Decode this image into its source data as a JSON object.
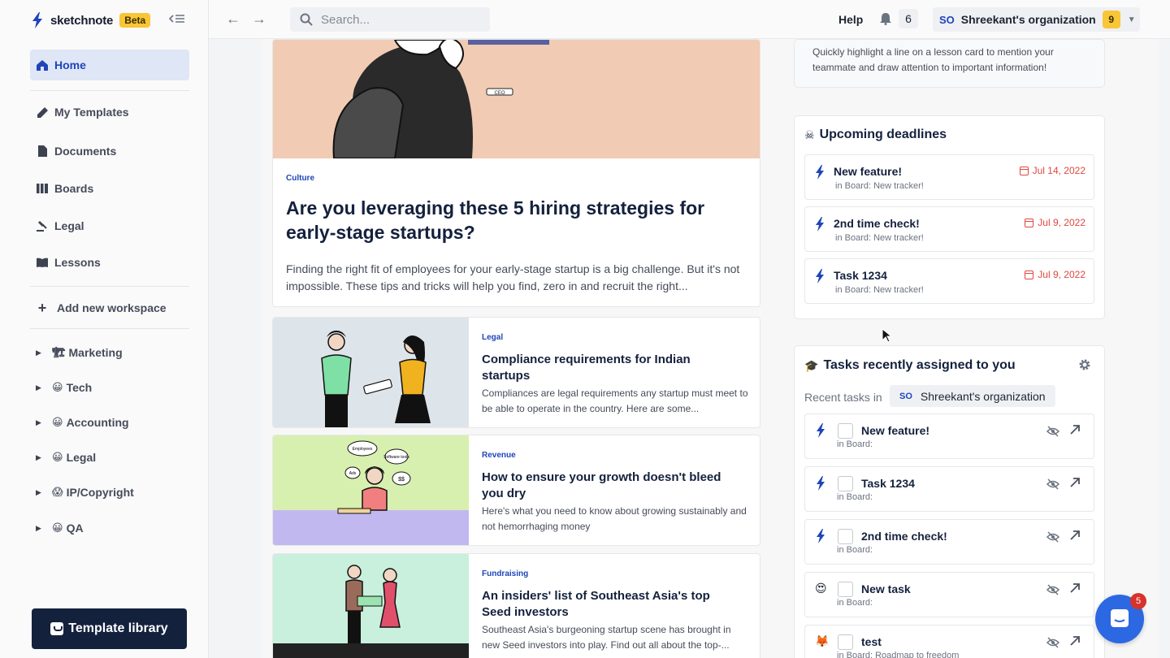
{
  "app": {
    "name": "sketchnote",
    "badge": "Beta"
  },
  "colors": {
    "brand_blue": "#1f45b8",
    "accent_yellow": "#f8c636",
    "deadline_red": "#e0463f",
    "dark_button": "#14213d"
  },
  "sidebar": {
    "nav": [
      {
        "label": "Home",
        "icon": "home-icon",
        "active": true
      },
      {
        "label": "My Templates",
        "icon": "pen-icon"
      },
      {
        "label": "Documents",
        "icon": "document-icon"
      },
      {
        "label": "Boards",
        "icon": "board-icon"
      },
      {
        "label": "Legal",
        "icon": "gavel-icon"
      },
      {
        "label": "Lessons",
        "icon": "book-icon"
      }
    ],
    "add_workspace": "Add new workspace",
    "workspaces": [
      {
        "label": "Marketing",
        "emoji": "🏗"
      },
      {
        "label": "Tech",
        "emoji": "😀"
      },
      {
        "label": "Accounting",
        "emoji": "😀"
      },
      {
        "label": "Legal",
        "emoji": "😀"
      },
      {
        "label": "IP/Copyright",
        "emoji": "😱"
      },
      {
        "label": "QA",
        "emoji": "😀"
      }
    ],
    "template_library": "Template library"
  },
  "topbar": {
    "search_placeholder": "Search...",
    "help": "Help",
    "notifications": "6",
    "org": {
      "abbr": "SO",
      "name": "Shreekant's organization",
      "count": "9"
    }
  },
  "feed": {
    "hero": {
      "badge_text": "CEO",
      "category": "Culture",
      "title": "Are you leveraging these 5 hiring strategies for early-stage startups?",
      "desc": "Finding the right fit of employees for your early-stage startup is a big challenge. But it's not impossible. These tips and tricks will help you find, zero in and recruit the right..."
    },
    "articles": [
      {
        "category": "Legal",
        "title": "Compliance requirements for Indian startups",
        "desc": "Compliances are legal requirements any startup must meet to be able to operate in the country. Here are some..."
      },
      {
        "category": "Revenue",
        "title": "How to ensure your growth doesn't bleed you dry",
        "desc": "Here's what you need to know about growing sustainably and not hemorrhaging money",
        "thumb_labels": [
          "Employees",
          "Software tools",
          "Ads",
          "$$"
        ]
      },
      {
        "category": "Fundraising",
        "title": "An insiders' list of Southeast Asia's top Seed investors",
        "desc": "Southeast Asia's burgeoning startup scene has brought in new Seed investors into play. Find out all about the top-..."
      }
    ]
  },
  "right": {
    "tip_text": "Quickly highlight a line on a lesson card to mention your teammate and draw attention to important information!",
    "deadlines": {
      "title": "Upcoming deadlines",
      "emoji": "☠",
      "items": [
        {
          "name": "New feature!",
          "board": "in Board: New tracker!",
          "date": "Jul 14, 2022"
        },
        {
          "name": "2nd time check!",
          "board": "in Board: New tracker!",
          "date": "Jul 9, 2022"
        },
        {
          "name": "Task 1234",
          "board": "in Board: New tracker!",
          "date": "Jul 9, 2022"
        }
      ]
    },
    "tasks": {
      "title": "Tasks recently assigned to you",
      "emoji": "🎓",
      "recent_label": "Recent tasks in",
      "org_abbr": "SO",
      "org_name": "Shreekant's organization",
      "items": [
        {
          "name": "New feature!",
          "board": "in Board:",
          "lead": "bolt"
        },
        {
          "name": "Task 1234",
          "board": "in Board:",
          "lead": "bolt"
        },
        {
          "name": "2nd time check!",
          "board": "in Board:",
          "lead": "bolt"
        },
        {
          "name": "New task",
          "board": "in Board:",
          "lead": "😍"
        },
        {
          "name": "test",
          "board": "in Board: Roadmap to freedom",
          "lead": "🦊"
        }
      ]
    }
  },
  "chat": {
    "badge": "5"
  }
}
